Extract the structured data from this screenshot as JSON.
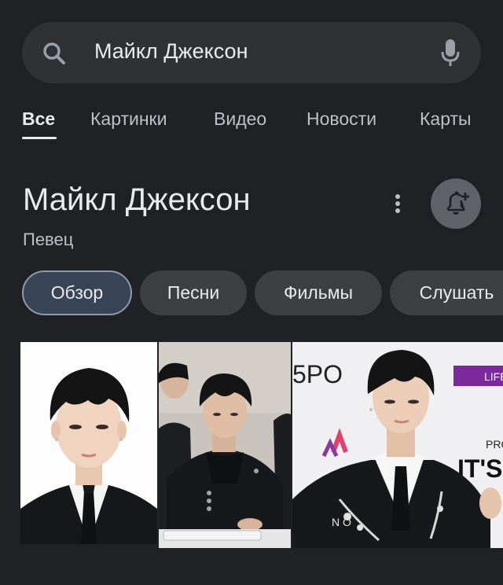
{
  "search": {
    "query": "Майкл Джексон"
  },
  "tabs": [
    {
      "label": "Все",
      "active": true
    },
    {
      "label": "Картинки",
      "active": false
    },
    {
      "label": "Видео",
      "active": false
    },
    {
      "label": "Новости",
      "active": false
    },
    {
      "label": "Карты",
      "active": false
    }
  ],
  "knowledge_panel": {
    "title": "Майкл Джексон",
    "subtitle": "Певец"
  },
  "chips": [
    {
      "label": "Обзор",
      "selected": true
    },
    {
      "label": "Песни",
      "selected": false
    },
    {
      "label": "Фильмы",
      "selected": false
    },
    {
      "label": "Слушать",
      "selected": false
    }
  ],
  "images": {
    "photo3": {
      "backdrop_text": "5PO",
      "badge_text": "LIFE",
      "sign_small": "PRO",
      "sign_large": "IT'S",
      "jacket_letters": "N O"
    }
  },
  "colors": {
    "background": "#202124",
    "search_bg": "#303134",
    "chip_bg": "#3c4043",
    "chip_selected_bg": "#394457",
    "text_primary": "#e8eaed",
    "text_secondary": "#bdc1c6",
    "icon_accent": "#9aa0a6"
  }
}
